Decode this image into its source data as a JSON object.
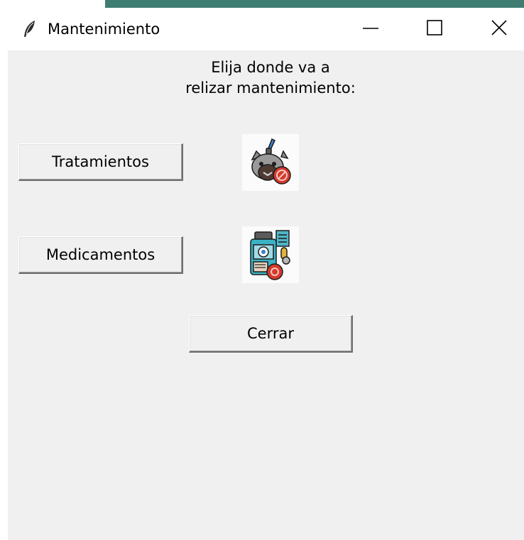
{
  "window": {
    "title": "Mantenimiento"
  },
  "prompt": {
    "line1": "Elija donde va a",
    "line2": "relizar mantenimiento:"
  },
  "buttons": {
    "tratamientos": "Tratamientos",
    "medicamentos": "Medicamentos",
    "cerrar": "Cerrar"
  },
  "icons": {
    "app": "feather-icon",
    "minimize": "minimize-icon",
    "maximize": "maximize-icon",
    "close": "close-icon",
    "tratamientos": "pet-treatment-icon",
    "medicamentos": "medicine-bottle-icon"
  },
  "colors": {
    "taskbar_accent": "#3f7d72",
    "client_background": "#f0f0f0"
  }
}
